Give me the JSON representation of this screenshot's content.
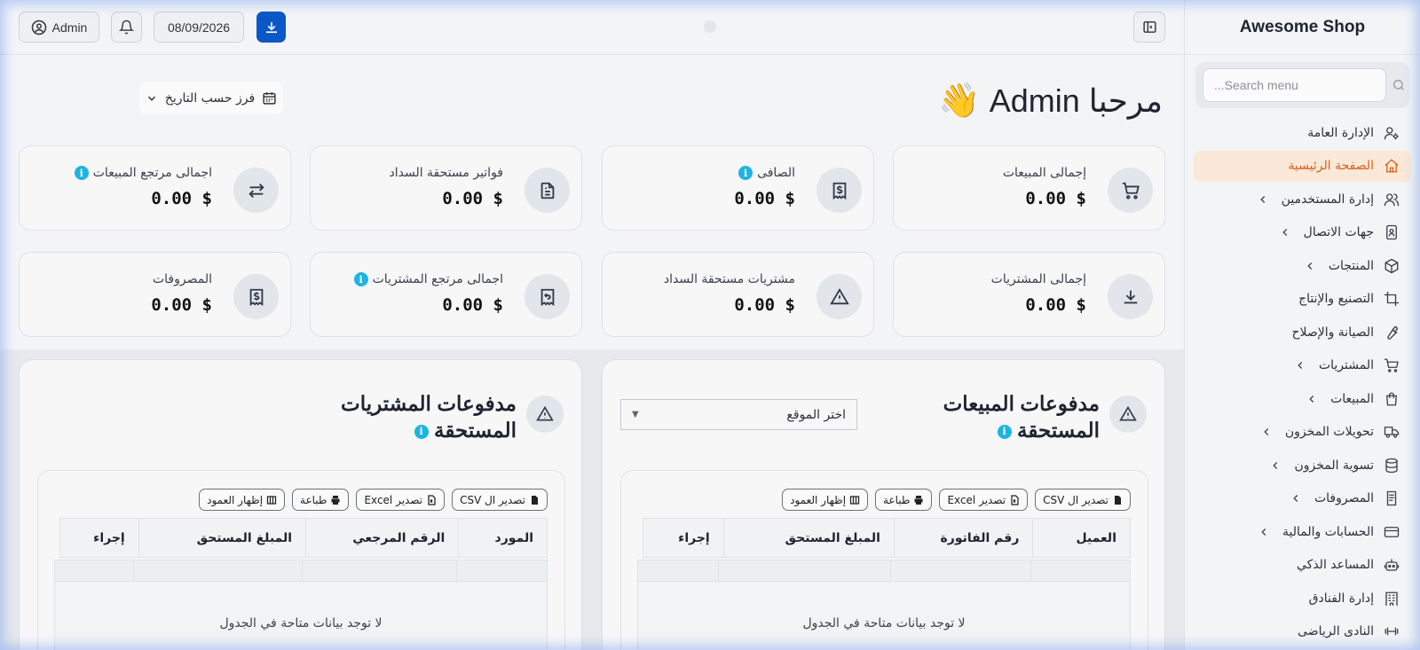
{
  "brand": "Awesome Shop",
  "search": {
    "placeholder": "...Search menu"
  },
  "menu": [
    {
      "label": "الإدارة العامة",
      "icon": "user-cog-icon",
      "chevron": false,
      "active": false
    },
    {
      "label": "الصفحة الرئيسية",
      "icon": "home-icon",
      "chevron": false,
      "active": true
    },
    {
      "label": "إدارة المستخدمين",
      "icon": "users-icon",
      "chevron": true,
      "active": false
    },
    {
      "label": "جهات الاتصال",
      "icon": "contact-book-icon",
      "chevron": true,
      "active": false
    },
    {
      "label": "المنتجات",
      "icon": "box-icon",
      "chevron": true,
      "active": false
    },
    {
      "label": "التصنيع والإنتاج",
      "icon": "crop-icon",
      "chevron": false,
      "active": false
    },
    {
      "label": "الصيانة والإصلاح",
      "icon": "wrench-icon",
      "chevron": false,
      "active": false
    },
    {
      "label": "المشتريات",
      "icon": "cart-icon",
      "chevron": true,
      "active": false
    },
    {
      "label": "المبيعات",
      "icon": "shopping-bag-icon",
      "chevron": true,
      "active": false
    },
    {
      "label": "تحويلات المخزون",
      "icon": "truck-icon",
      "chevron": true,
      "active": false
    },
    {
      "label": "تسوية المخزون",
      "icon": "database-icon",
      "chevron": true,
      "active": false
    },
    {
      "label": "المصروفات",
      "icon": "document-icon",
      "chevron": true,
      "active": false
    },
    {
      "label": "الحسابات والمالية",
      "icon": "credit-card-icon",
      "chevron": true,
      "active": false
    },
    {
      "label": "المساعد الذكي",
      "icon": "robot-icon",
      "chevron": false,
      "active": false
    },
    {
      "label": "إدارة الفنادق",
      "icon": "hotel-icon",
      "chevron": false,
      "active": false
    },
    {
      "label": "النادى الرياضى",
      "icon": "dumbbell-icon",
      "chevron": false,
      "active": false
    }
  ],
  "topbar": {
    "user": "Admin",
    "date": "08/09/2026"
  },
  "welcome": {
    "text": "مرحبا Admin",
    "emoji": "👋"
  },
  "sort_label": "فرز حسب التاريخ",
  "stats": [
    {
      "label": "إجمالى المبيعات",
      "value": "0.00 $",
      "icon": "cart-icon",
      "info": false
    },
    {
      "label": "الصافى",
      "value": "0.00 $",
      "icon": "receipt-dollar-icon",
      "info": true
    },
    {
      "label": "فواتير مستحقة السداد",
      "value": "0.00 $",
      "icon": "file-text-icon",
      "info": false
    },
    {
      "label": "اجمالى مرتجع المبيعات",
      "value": "0.00 $",
      "icon": "arrows-exchange-icon",
      "info": true
    },
    {
      "label": "إجمالى المشتريات",
      "value": "0.00 $",
      "icon": "download-circle-icon",
      "info": false
    },
    {
      "label": "مشتريات مستحقة السداد",
      "value": "0.00 $",
      "icon": "warning-icon",
      "info": false
    },
    {
      "label": "اجمالى مرتجع المشتريات",
      "value": "0.00 $",
      "icon": "receipt-return-icon",
      "info": true
    },
    {
      "label": "المصروفات",
      "value": "0.00 $",
      "icon": "receipt-dollar-icon",
      "info": false
    }
  ],
  "panels": {
    "sales": {
      "title_line1": "مدفوعات المبيعات",
      "title_line2": "المستحقة",
      "location_select": "اختر الموقع",
      "actions": [
        "تصدير ال CSV",
        "تصدير Excel",
        "طباعة",
        "إظهار العمود"
      ],
      "columns": [
        "العميل",
        "رقم الفاتورة",
        "المبلغ المستحق",
        "إجراء"
      ],
      "empty": "لا توجد بيانات متاحة في الجدول"
    },
    "purchases": {
      "title_line1": "مدفوعات المشتريات",
      "title_line2": "المستحقة",
      "actions": [
        "تصدير ال CSV",
        "تصدير Excel",
        "طباعة",
        "إظهار العمود"
      ],
      "columns": [
        "المورد",
        "الرقم المرجعي",
        "المبلغ المستحق",
        "إجراء"
      ],
      "empty": "لا توجد بيانات متاحة في الجدول"
    }
  },
  "colors": {
    "accent": "#0a57c8",
    "active_menu_bg": "#fbe8d8",
    "active_menu_text": "#d8621b",
    "info": "#1eb4e0"
  }
}
